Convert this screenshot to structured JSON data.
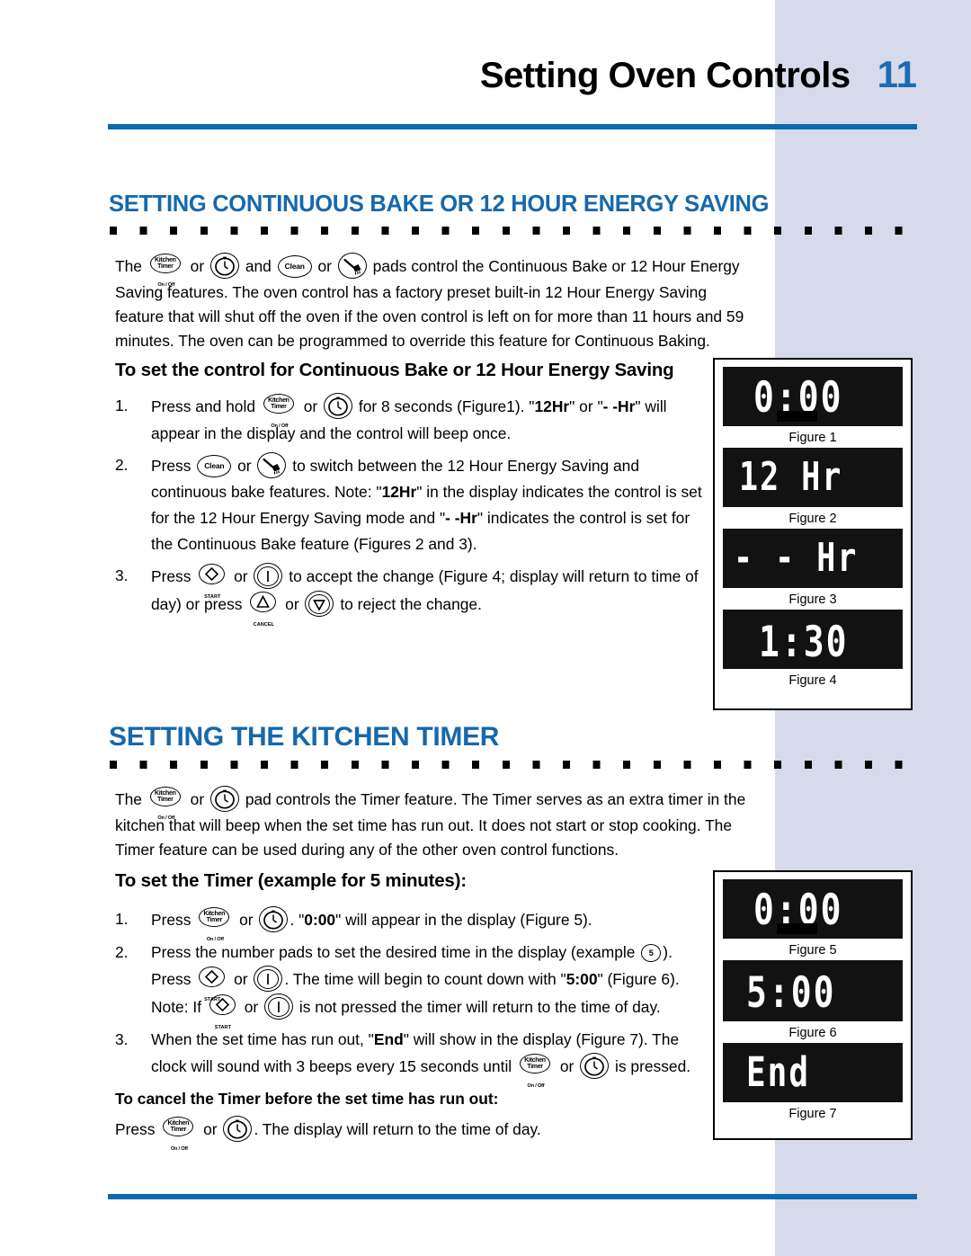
{
  "header": {
    "title": "Setting Oven Controls",
    "page_number": "11"
  },
  "section1": {
    "heading": "SETTING CONTINUOUS BAKE OR 12 HOUR ENERGY SAVING",
    "intro_a": "The",
    "intro_b": "or",
    "intro_c": "and",
    "intro_d": "or",
    "intro_e": "pads control the Continuous Bake or 12 Hour Energy Saving features. The oven control has a factory preset built-in 12 Hour Energy Saving feature that will shut off the oven if the oven control is left on for more than 11 hours and 59 minutes. The oven can be programmed to override this feature for Continuous Baking.",
    "sub_heading": "To set the control for Continuous Bake or 12 Hour Energy Saving",
    "step1": {
      "num": "1.",
      "t1": "Press and hold",
      "t2": "or",
      "t3": "for 8 seconds (Figure1). \"",
      "b1": "12Hr",
      "t4": "\" or \"",
      "b2": "- -Hr",
      "t5": "\" will appear in the display and the control will beep once."
    },
    "step2": {
      "num": "2.",
      "t1": "Press",
      "t2": "or",
      "t3": "to switch between the 12 Hour Energy Saving and continuous bake features. Note: \"",
      "b1": "12Hr",
      "t4": "\" in the display indicates the control is set for the 12 Hour Energy Saving mode and \"",
      "b2": "- -Hr",
      "t5": "\" indicates the control is set for the Continuous Bake feature (Figures 2 and 3)."
    },
    "step3": {
      "num": "3.",
      "t1": "Press",
      "t2": "or",
      "t3": "to accept the change (Figure 4; display will return to time of day) or press",
      "t4": "or",
      "t5": "to reject the change."
    }
  },
  "section2": {
    "heading": "SETTING THE KITCHEN TIMER",
    "intro_a": "The",
    "intro_b": "or",
    "intro_c": "pad controls the Timer feature. The Timer serves as an extra timer in the kitchen that will beep when the set time has run out. It does not start or stop cooking. The Timer feature can be used during any of the other oven control functions.",
    "sub_heading": "To set the Timer (example for 5 minutes):",
    "step1": {
      "num": "1.",
      "t1": "Press",
      "t2": "or",
      "t3": ". \"",
      "b1": "0:00",
      "t4": "\" will appear in the display (Figure 5)."
    },
    "step2": {
      "num": "2.",
      "t1": "Press the number pads to set the desired time in the display (example",
      "t2": ").",
      "t3": "Press",
      "t4": "or",
      "t5": ". The time will begin to count down with \"",
      "b1": "5:00",
      "t6": "\" (Figure 6).",
      "t7": "Note: If",
      "t8": "or",
      "t9": "is not pressed the timer will return to the time of day."
    },
    "step3": {
      "num": "3.",
      "t1": "When the set time has run out, \"",
      "b1": "End",
      "t2": "\" will show in the display (Figure 7). The clock will sound with 3 beeps every 15 seconds until",
      "t3": "or",
      "t4": "is pressed."
    },
    "cancel_heading": "To cancel the Timer before the set time has run out:",
    "cancel_step": {
      "t1": "Press",
      "t2": "or",
      "t3": ".  The display will return to the time of day."
    }
  },
  "pads": {
    "kitchen_timer": {
      "line1": "Kitchen",
      "line2": "Timer",
      "sub": "On / Off"
    },
    "clean": {
      "label": "Clean"
    },
    "start": {
      "caption": "START"
    },
    "cancel": {
      "caption": "CANCEL"
    },
    "number_five": {
      "label": "5"
    }
  },
  "figures": [
    {
      "id": "fig1",
      "display": "0:00",
      "caption": "Figure 1",
      "has_block": true
    },
    {
      "id": "fig2",
      "display": "12 Hr",
      "caption": "Figure 2",
      "has_block": false
    },
    {
      "id": "fig3",
      "display": "- - Hr",
      "caption": "Figure 3",
      "has_block": false
    },
    {
      "id": "fig4",
      "display": "1:30",
      "caption": "Figure 4",
      "has_block": false
    },
    {
      "id": "fig5",
      "display": "0:00",
      "caption": "Figure 5",
      "has_block": true
    },
    {
      "id": "fig6",
      "display": "5:00",
      "caption": "Figure 6",
      "has_block": false
    },
    {
      "id": "fig7",
      "display": "End",
      "caption": "Figure 7",
      "has_block": false
    }
  ],
  "colors": {
    "heading_blue": "#1668ac",
    "rule_blue": "#0b69b0",
    "side_band": "#d6daea",
    "lcd_background": "#121212",
    "lcd_text": "#ffffff"
  }
}
